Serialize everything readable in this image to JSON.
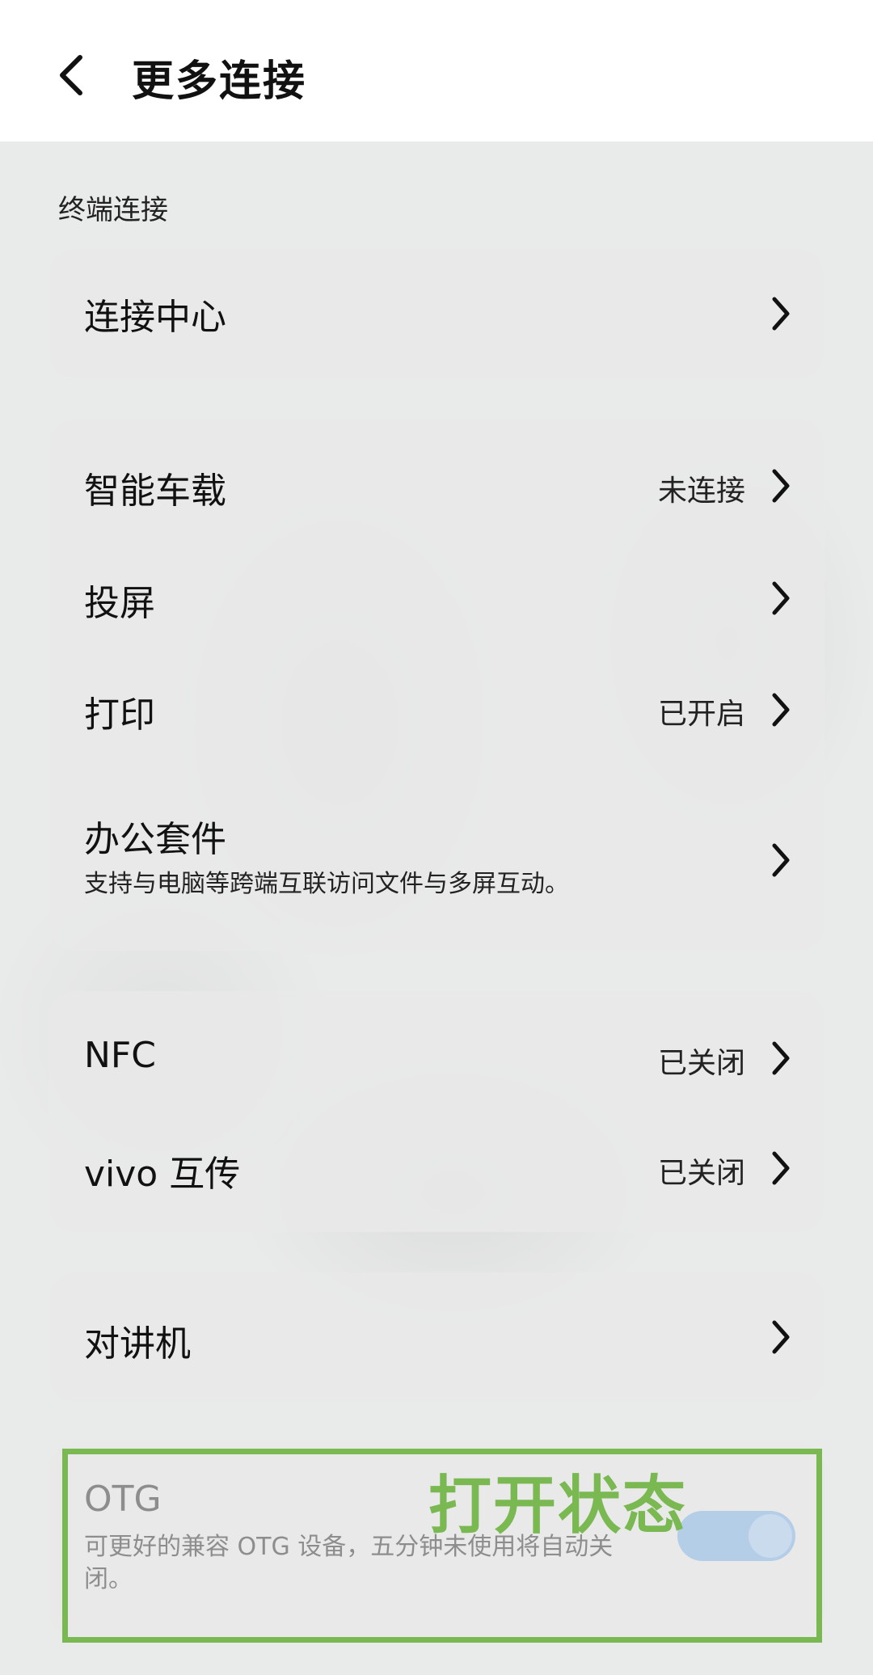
{
  "header": {
    "title": "更多连接"
  },
  "sections": {
    "terminal_label": "终端连接"
  },
  "rows": {
    "connect_center": {
      "label": "连接中心"
    },
    "car": {
      "label": "智能车载",
      "value": "未连接"
    },
    "cast": {
      "label": "投屏"
    },
    "print": {
      "label": "打印",
      "value": "已开启"
    },
    "office": {
      "label": "办公套件",
      "sub": "支持与电脑等跨端互联访问文件与多屏互动。"
    },
    "nfc": {
      "label": "NFC",
      "value": "已关闭"
    },
    "vivo_share": {
      "label": "vivo 互传",
      "value": "已关闭"
    },
    "walkie": {
      "label": "对讲机"
    },
    "otg": {
      "label": "OTG",
      "desc": "可更好的兼容 OTG 设备，五分钟未使用将自动关闭。",
      "enabled": true
    }
  },
  "annotation": {
    "text": "打开状态",
    "color": "#7ab852"
  },
  "colors": {
    "toggle_on": "#94bde6",
    "highlight": "#7ab852"
  },
  "icons": {
    "back": "chevron-left-icon",
    "row": "chevron-right-icon"
  }
}
